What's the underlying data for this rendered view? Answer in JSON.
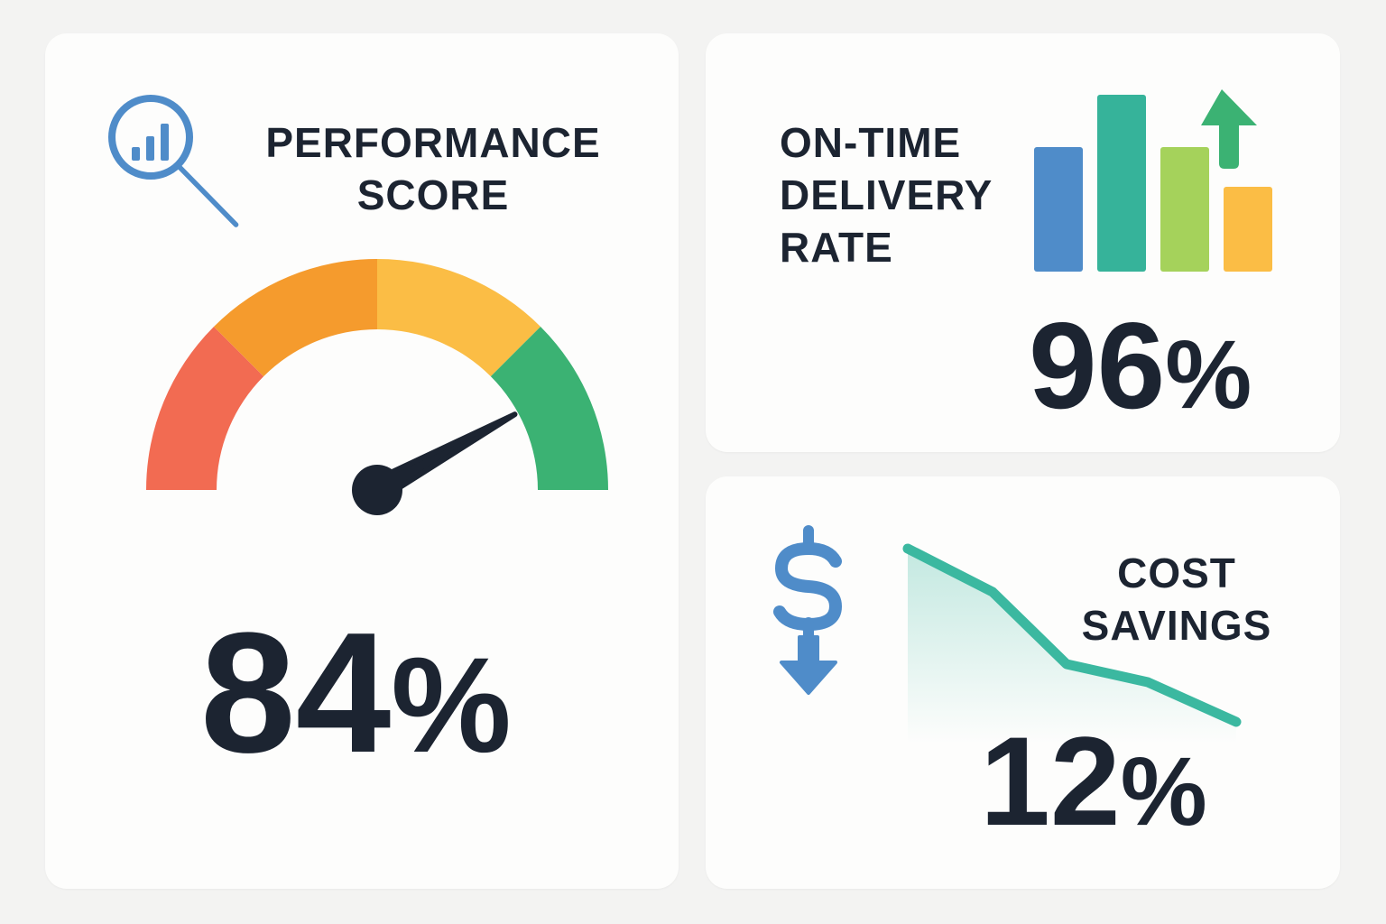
{
  "performance": {
    "title_line1": "PERFORMANCE",
    "title_line2": "SCORE",
    "value": "84",
    "unit": "%",
    "gauge_level": 0.84,
    "segment_colors": [
      "#f26b52",
      "#f59b2d",
      "#fbbd45",
      "#3bb273"
    ],
    "needle_color": "#1c2431",
    "icon": "search-chart-icon",
    "icon_color": "#4f8cc9"
  },
  "delivery": {
    "title_line1": "ON-TIME",
    "title_line2": "DELIVERY",
    "title_line3": "RATE",
    "value": "96",
    "unit": "%",
    "bar_colors": [
      "#4f8cc9",
      "#36b39a",
      "#a5d25b",
      "#fbbd45"
    ],
    "arrow_icon": "arrow-up-icon",
    "arrow_color": "#3bb273"
  },
  "savings": {
    "title_line1": "COST",
    "title_line2": "SAVINGS",
    "value": "12",
    "unit": "%",
    "line_color": "#3bb8a0",
    "icon": "dollar-down-icon",
    "icon_color": "#4f8cc9"
  }
}
